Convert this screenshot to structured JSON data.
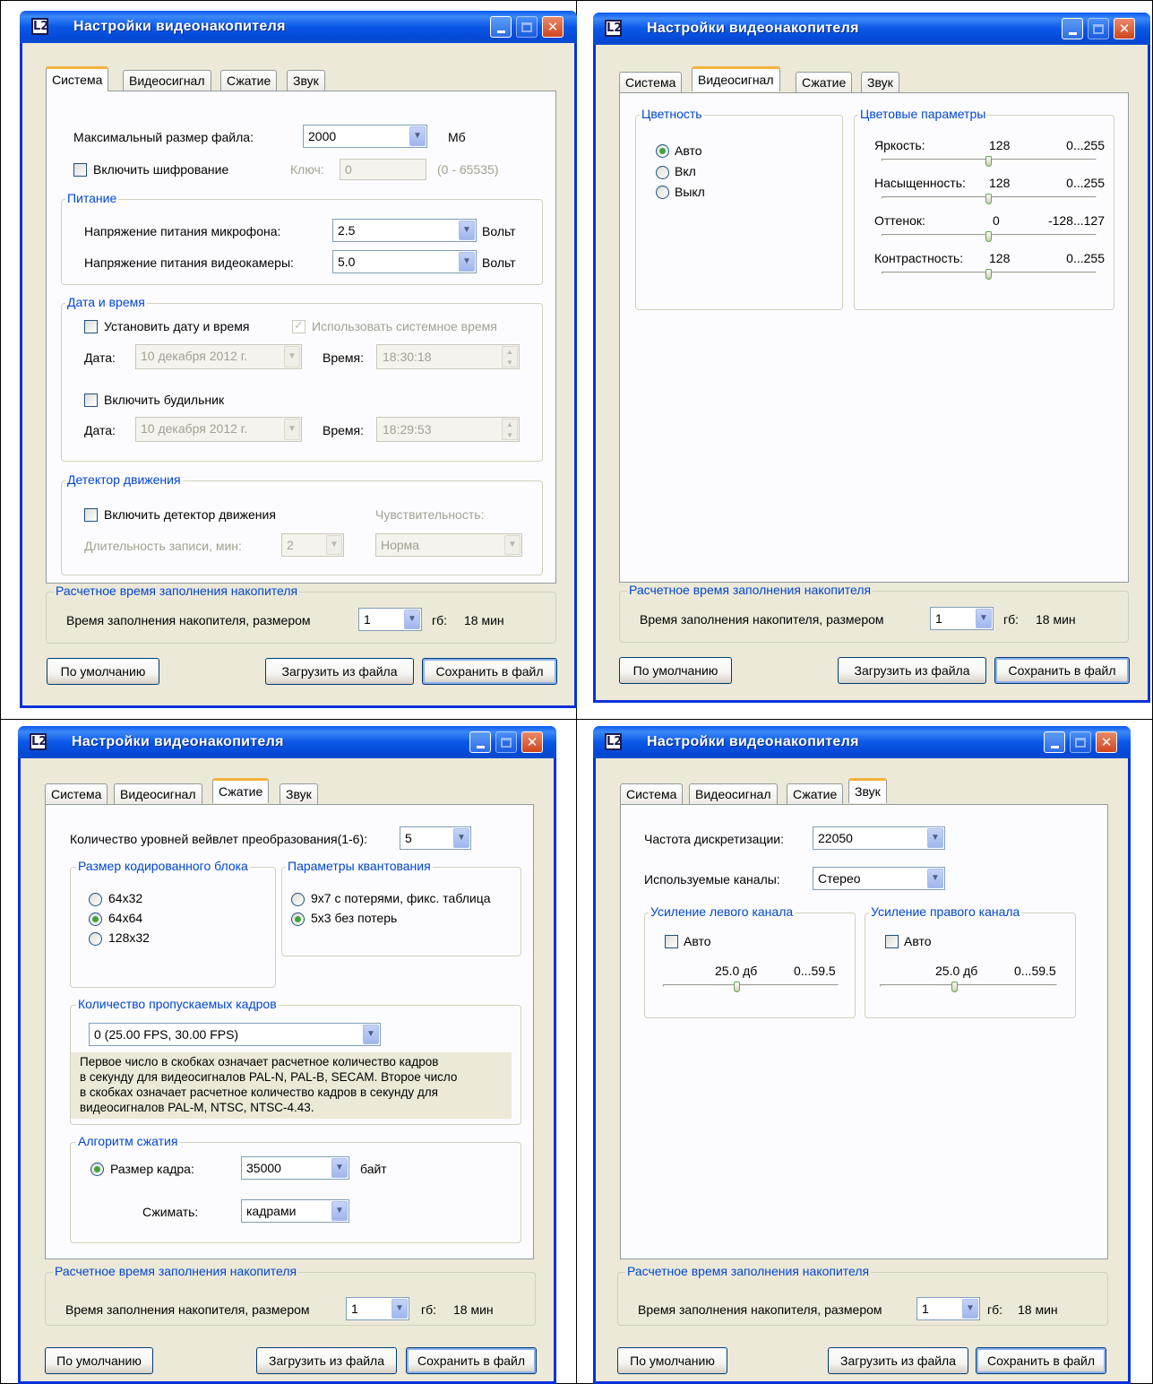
{
  "window_title": "Настройки видеонакопителя",
  "logo_text": "L2",
  "tabs": [
    "Система",
    "Видеосигнал",
    "Сжатие",
    "Звук"
  ],
  "footer": {
    "group_label": "Расчетное время заполнения накопителя",
    "fill_label": "Время заполнения накопителя, размером",
    "size_value": "1",
    "unit": "гб:",
    "time": "18 мин",
    "btn_default": "По умолчанию",
    "btn_load": "Загрузить из файла",
    "btn_save": "Сохранить в файл"
  },
  "system": {
    "max_file_label": "Максимальный размер файла:",
    "max_file_value": "2000",
    "max_file_unit": "Мб",
    "encrypt_label": "Включить шифрование",
    "key_label": "Ключ:",
    "key_value": "0",
    "key_range": "(0 - 65535)",
    "power_group": "Питание",
    "mic_label": "Напряжение питания микрофона:",
    "mic_value": "2.5",
    "cam_label": "Напряжение питания видеокамеры:",
    "cam_value": "5.0",
    "volt": "Вольт",
    "datetime_group": "Дата и время",
    "set_dt_label": "Установить дату и время",
    "use_sys_label": "Использовать системное время",
    "date_label": "Дата:",
    "time_label": "Время:",
    "date1": "10 декабря  2012 г.",
    "time1": "18:30:18",
    "alarm_label": "Включить будильник",
    "date2": "10 декабря  2012 г.",
    "time2": "18:29:53",
    "motion_group": "Детектор движения",
    "motion_label": "Включить детектор движения",
    "sens_label": "Чувствительность:",
    "dur_label": "Длительность записи, мин:",
    "dur_value": "2",
    "sens_value": "Норма"
  },
  "video": {
    "color_group": "Цветность",
    "radio_auto": "Авто",
    "radio_on": "Вкл",
    "radio_off": "Выкл",
    "params_group": "Цветовые параметры",
    "params": [
      {
        "label": "Яркость:",
        "value": "128",
        "range": "0...255",
        "level": 0.5
      },
      {
        "label": "Насыщенность:",
        "value": "128",
        "range": "0...255",
        "level": 0.5
      },
      {
        "label": "Оттенок:",
        "value": "0",
        "range": "-128...127",
        "level": 0.5
      },
      {
        "label": "Контрастность:",
        "value": "128",
        "range": "0...255",
        "level": 0.5
      }
    ]
  },
  "compress": {
    "levels_label": "Количество уровней вейвлет преобразования(1-6):",
    "levels_value": "5",
    "block_group": "Размер кодированного блока",
    "blocks": [
      "64x32",
      "64x64",
      "128x32"
    ],
    "quant_group": "Параметры квантования",
    "quant": [
      "9x7 с потерями, фикс. таблица",
      "5x3 без потерь"
    ],
    "skip_group": "Количество пропускаемых кадров",
    "skip_value": "0    (25.00 FPS, 30.00 FPS)",
    "info_lines": [
      "Первое число в скобках означает расчетное количество кадров",
      "в секунду для видеосигналов PAL-N, PAL-B, SECAM. Второе число",
      "в скобках означает расчетное количество кадров в секунду для",
      "видеосигналов PAL-M, NTSC, NTSC-4.43."
    ],
    "algo_group": "Алгоритм сжатия",
    "frame_size_label": "Размер кадра:",
    "frame_size_value": "35000",
    "bytes": "байт",
    "compress_label": "Сжимать:",
    "compress_value": "кадрами"
  },
  "sound": {
    "rate_label": "Частота дискретизации:",
    "rate_value": "22050",
    "channels_label": "Используемые каналы:",
    "channels_value": "Стерео",
    "left_group": "Усиление левого канала",
    "right_group": "Усиление правого канала",
    "auto": "Авто",
    "gain_value": "25.0 дб",
    "gain_range": "0...59.5",
    "gain_level": 0.42
  }
}
